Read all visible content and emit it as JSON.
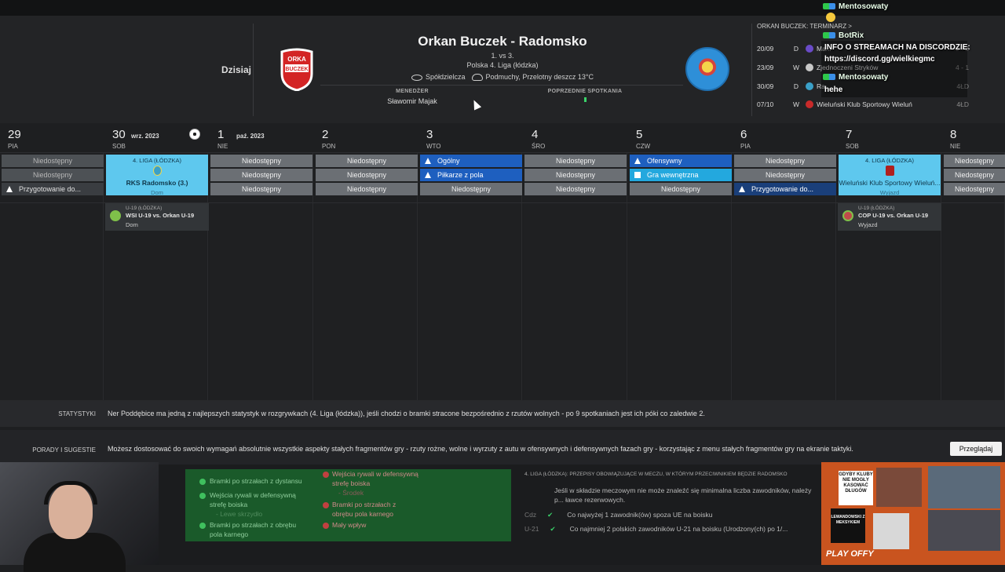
{
  "header": {
    "today_label": "Dzisiaj",
    "match_title": "Orkan Buczek - Radomsko",
    "standing": "1. vs 3.",
    "league": "Polska 4. Liga (łódzka)",
    "stadium": "Spółdzielcza",
    "weather": "Podmuchy, Przelotny deszcz 13°C",
    "manager_label": "MENEDŻER",
    "manager_name": "Sławomir Majak",
    "prev_label": "POPRZEDNIE SPOTKANIA"
  },
  "fixtures": {
    "title": "ORKAN BUCZEK: TERMINARZ >",
    "rows": [
      {
        "date": "20/09",
        "type": "D",
        "name": "Ma...",
        "score": "9 - 2",
        "color": "#6a4bc8"
      },
      {
        "date": "23/09",
        "type": "W",
        "name": "Zjednoczeni Stryków",
        "score": "4 - 1",
        "color": "#c8c8c8"
      },
      {
        "date": "30/09",
        "type": "D",
        "name": "Ra...",
        "score": "4ŁD",
        "color": "#3aa0c8"
      },
      {
        "date": "07/10",
        "type": "W",
        "name": "Wieluński Klub Sportowy Wieluń",
        "score": "4ŁD",
        "color": "#c82a2a"
      }
    ]
  },
  "chat": {
    "user1": "Mentosowaty",
    "bot": "BotRix",
    "bot_msg1": "INFO O STREAMACH NA DISCORDZIE:",
    "bot_msg2": "https://discord.gg/wielkiegmc",
    "user2": "Mentosowaty",
    "user2_msg": "hehe"
  },
  "calendar": {
    "days": [
      {
        "num": "29",
        "name": "PIA",
        "month": ""
      },
      {
        "num": "30",
        "name": "SOB",
        "month": "wrz. 2023"
      },
      {
        "num": "1",
        "name": "NIE",
        "month": "paź. 2023"
      },
      {
        "num": "2",
        "name": "PON",
        "month": ""
      },
      {
        "num": "3",
        "name": "WTO",
        "month": ""
      },
      {
        "num": "4",
        "name": "ŚRO",
        "month": ""
      },
      {
        "num": "5",
        "name": "CZW",
        "month": ""
      },
      {
        "num": "6",
        "name": "PIA",
        "month": ""
      },
      {
        "num": "7",
        "name": "SOB",
        "month": ""
      },
      {
        "num": "8",
        "name": "NIE",
        "month": ""
      }
    ],
    "na": "Niedostępny",
    "prep": "Przygotowanie do...",
    "general": "Ogólny",
    "outfield": "Piłkarze z pola",
    "offensive": "Ofensywny",
    "internal": "Gra wewnętrzna",
    "match1": {
      "league": "4. LIGA (ŁÓDZKA)",
      "opponent": "RKS Radomsko (3.)",
      "venue": "Dom"
    },
    "match2": {
      "league": "4. LIGA (ŁÓDZKA)",
      "opponent": "Wieluński Klub Sportowy Wieluń...",
      "venue": "Wyjazd"
    },
    "youth1": {
      "league": "U-19 (ŁÓDZKA)",
      "title": "WSI U-19 vs. Orkan U-19",
      "venue": "Dom"
    },
    "youth2": {
      "league": "U-19 (ŁÓDZKA)",
      "title": "COP U-19 vs. Orkan U-19",
      "venue": "Wyjazd"
    }
  },
  "stats": {
    "label": "STATYSTYKI",
    "text": "Ner Poddębice ma jedną z najlepszych statystyk w rozgrywkach (4. Liga (łódzka)), jeśli chodzi o bramki stracone bezpośrednio z rzutów wolnych - po 9 spotkaniach jest ich póki co zaledwie 2."
  },
  "tips": {
    "label": "PORADY I SUGESTIE",
    "text": "Możesz dostosować do swoich wymagań absolutnie wszystkie aspekty stałych fragmentów gry - rzuty rożne, wolne i wyrzuty z autu w ofensywnych i defensywnych fazach gry - korzystając z menu stałych fragmentów gry na ekranie taktyki.",
    "button": "Przeglądaj"
  },
  "bottom": {
    "g1": "...",
    "g2": "Bramki po strzałach z dystansu",
    "g3": "Wejścia rywali w defensywną",
    "g3b": "strefę boiska",
    "g3c": "- Lewe skrzydło",
    "g4": "Bramki po strzałach z obrębu",
    "g4b": "pola karnego",
    "r1": "Wejścia rywali w defensywną",
    "r1b": "strefę boiska",
    "r1c": "- Środek",
    "r2": "Bramki po strzałach z",
    "r2b": "obrębu pola karnego",
    "r3": "Mały wpływ",
    "rules_title": "4. LIGA (ŁÓDZKA): PRZEPISY OBOWIĄZUJĄCE W MECZU, W KTÓRYM PRZECIWNIKIEM BĘDZIE RADOMSKO",
    "rules_text": "Jeśli w składzie meczowym nie może znaleźć się minimalna liczba zawodników, należy p... ławce rezerwowych.",
    "rule1_tag": "Cdz",
    "rule1": "Co najwyżej 1 zawodnik(ów) spoza UE na boisku",
    "rule2_tag": "U-21",
    "rule2": "Co najmniej 2 polskich zawodników U-21 na boisku (Urodzony(ch) po 1/..."
  },
  "overlay": {
    "note1": "GDYBY KLUBY NIE MOGŁY KASOWAĆ DŁUGÓW",
    "note2": "LEWANDOWSKI Z MEKSYKIEM",
    "logo": "PLAY OFFY"
  }
}
